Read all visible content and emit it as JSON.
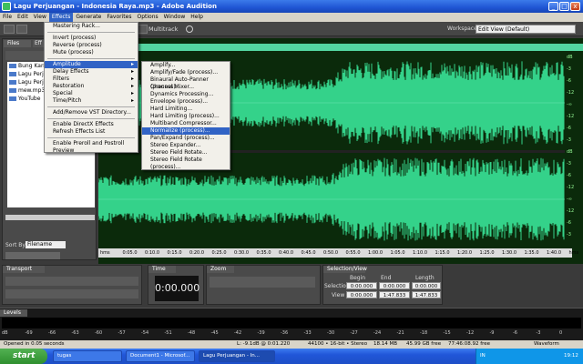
{
  "window": {
    "title": "Lagu Perjuangan - Indonesia Raya.mp3 - Adobe Audition",
    "minimize": "_",
    "maximize": "□",
    "close": "x"
  },
  "menubar": [
    "File",
    "Edit",
    "View",
    "Effects",
    "Generate",
    "Favorites",
    "Options",
    "Window",
    "Help"
  ],
  "toolbar": {
    "multitrack": "Multitrack",
    "workspace_label": "Workspace:",
    "workspace_value": "Edit View (Default)"
  },
  "files": {
    "tab": "Files",
    "tab2": "Eff",
    "items": [
      "Bung Karn",
      "Lagu Perj",
      "Lagu Perj",
      "mew.mp3",
      "YouTube"
    ],
    "sort_label": "Sort By:",
    "sort_value": "Filename"
  },
  "effects_menu": {
    "items": [
      "Mastering Rack...",
      "Invert (process)",
      "Reverse (process)",
      "Mute (process)",
      "Amplitude",
      "Delay Effects",
      "Filters",
      "Restoration",
      "Special",
      "Time/Pitch",
      "Add/Remove VST Directory...",
      "Enable DirectX Effects",
      "Refresh Effects List",
      "Enable Preroll and Postroll Preview"
    ],
    "arrow": "▸"
  },
  "amplitude_menu": [
    "Amplify...",
    "Amplify/Fade (process)...",
    "Binaural Auto-Panner (process)...",
    "Channel Mixer...",
    "Dynamics Processing...",
    "Envelope (process)...",
    "Hard Limiting...",
    "Hard Limiting (process)...",
    "Multiband Compressor...",
    "Normalize (process)...",
    "Pan/Expand (process)...",
    "Stereo Expander...",
    "Stereo Field Rotate...",
    "Stereo Field Rotate (process)..."
  ],
  "timeline": [
    "hms",
    "0:05.0",
    "0:10.0",
    "0:15.0",
    "0:20.0",
    "0:25.0",
    "0:30.0",
    "0:35.0",
    "0:40.0",
    "0:45.0",
    "0:50.0",
    "0:55.0",
    "1:00.0",
    "1:05.0",
    "1:10.0",
    "1:15.0",
    "1:20.0",
    "1:25.0",
    "1:30.0",
    "1:35.0",
    "1:40.0",
    "hms"
  ],
  "db_scale": [
    "dB",
    "-3",
    "-6",
    "-12",
    "-∞",
    "-12",
    "-6",
    "-3",
    "dB",
    "-3",
    "-6",
    "-12",
    "-∞",
    "-12",
    "-6",
    "-3"
  ],
  "transport": {
    "tab": "Transport"
  },
  "time": {
    "tab": "Time",
    "display": "0:00.000"
  },
  "zoom": {
    "tab": "Zoom"
  },
  "selection": {
    "tab": "Selection/View",
    "begin": "Begin",
    "end": "End",
    "length": "Length",
    "sel_label": "Selection",
    "view_label": "View",
    "sel_begin": "0:00.000",
    "sel_end": "0:00.000",
    "sel_length": "0:00.000",
    "view_begin": "0:00.000",
    "view_end": "1:47.833",
    "view_length": "1:47.833"
  },
  "levels": {
    "tab": "Levels",
    "ticks": [
      "dB",
      "-69",
      "-66",
      "-63",
      "-60",
      "-57",
      "-54",
      "-51",
      "-48",
      "-45",
      "-42",
      "-39",
      "-36",
      "-33",
      "-30",
      "-27",
      "-24",
      "-21",
      "-18",
      "-15",
      "-12",
      "-9",
      "-6",
      "-3",
      "0"
    ]
  },
  "status": {
    "opened": "Opened in 0.05 seconds",
    "l": "L: -9.1dB @ 0:01.220",
    "format": "44100 • 16-bit • Stereo",
    "size": "18.14 MB",
    "free": "45.99 GB free",
    "time_free": "77:46:08.92 free",
    "mode": "Waveform"
  },
  "taskbar": {
    "start": "start",
    "tasks": [
      "tugas",
      "Document1 - Microsof...",
      "Lagu Perjuangan - In..."
    ],
    "clock": "19:12",
    "lang": "IN"
  },
  "colors": {
    "wave": "#34d28a",
    "wave_bg": "#0b2a0b",
    "accent": "#3163c5"
  }
}
